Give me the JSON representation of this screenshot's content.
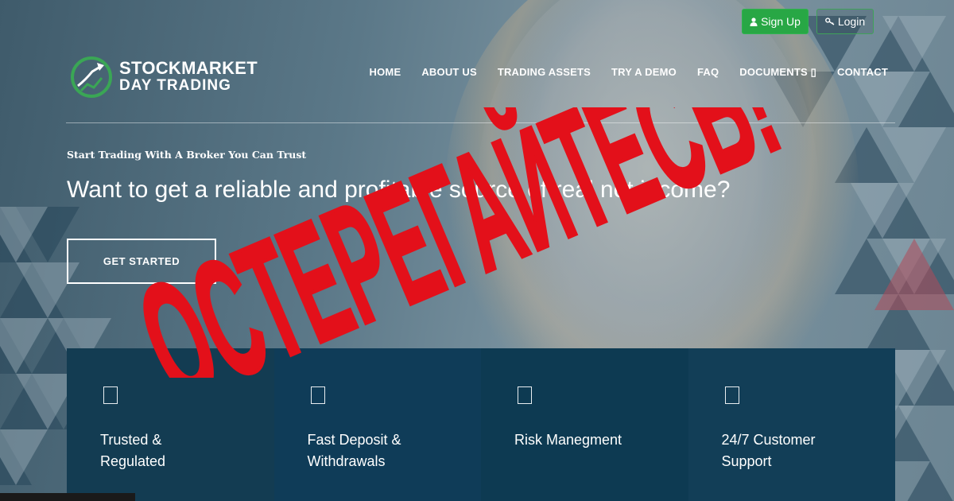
{
  "auth": {
    "signup_label": "Sign Up",
    "signup_icon": "user-icon",
    "login_label": "Login",
    "login_icon": "key-icon"
  },
  "brand": {
    "line1": "STOCKMARKET",
    "line2": "DAY TRADING",
    "logo_icon": "chart-arrow-logo-icon",
    "accent_color": "#28a745"
  },
  "nav": {
    "items": [
      "HOME",
      "ABOUT US",
      "TRADING ASSETS",
      "TRY A DEMO",
      "FAQ",
      "DOCUMENTS ▯",
      "CONTACT"
    ]
  },
  "hero": {
    "tagline": "Start Trading With A Broker You Can Trust",
    "headline": "Want to get a reliable and profitable source of real net income?",
    "cta_label": "GET STARTED"
  },
  "features": [
    {
      "icon": "shield-icon",
      "label": "Trusted & Regulated"
    },
    {
      "icon": "wallet-icon",
      "label": "Fast Deposit & Withdrawals"
    },
    {
      "icon": "chart-icon",
      "label": "Risk Manegment"
    },
    {
      "icon": "headset-icon",
      "label": "24/7 Customer Support"
    }
  ],
  "overlay": {
    "warning_text": "ОСТЕРЕГАЙТЕСЬ!",
    "warning_color": "#e3101a"
  }
}
